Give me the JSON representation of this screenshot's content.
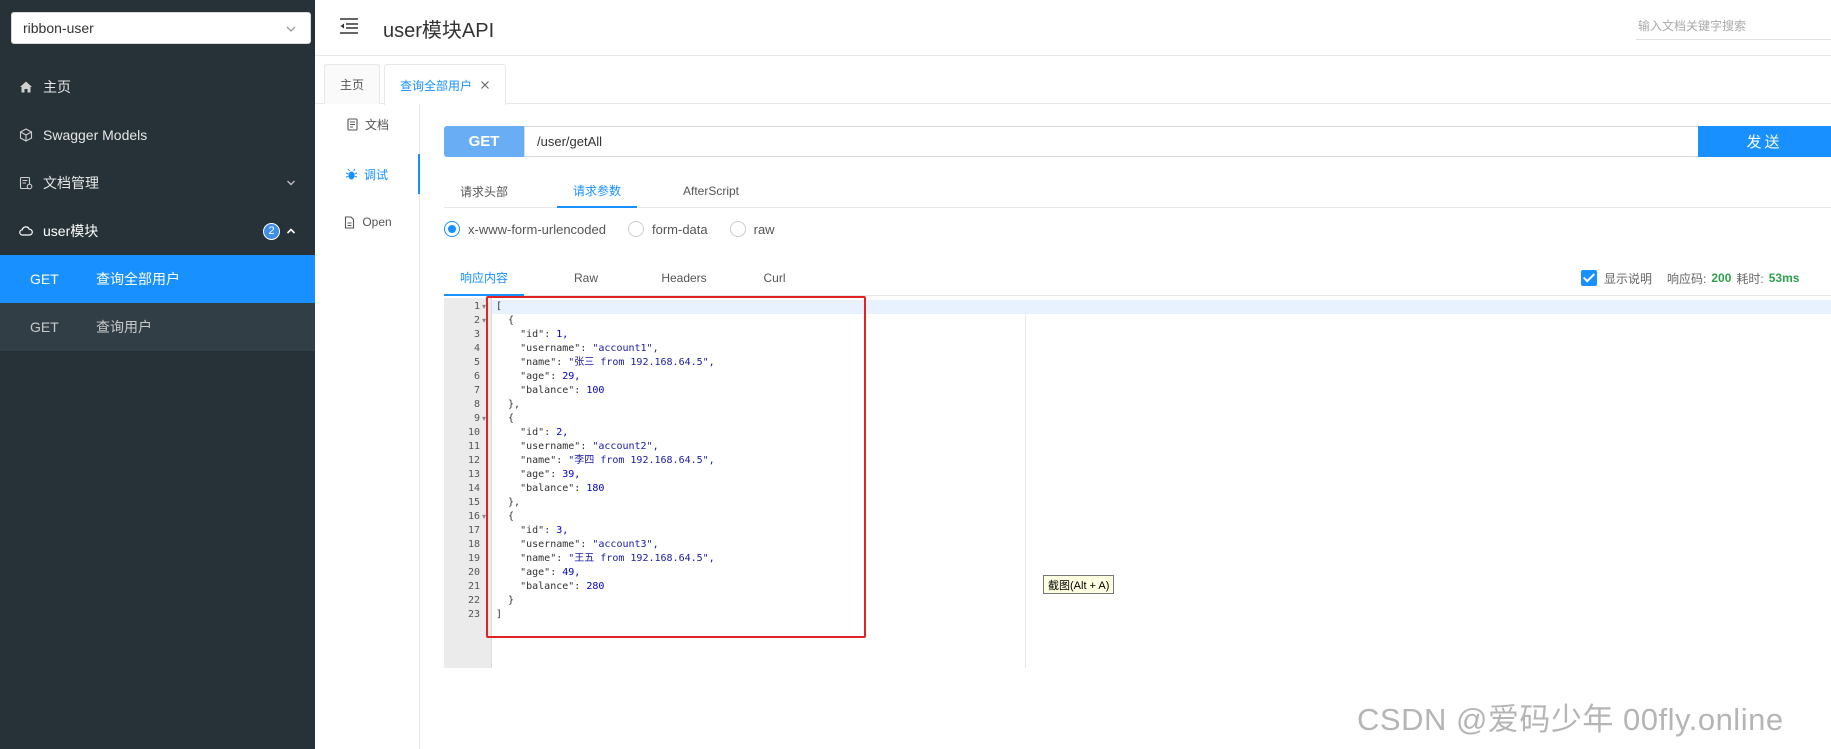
{
  "sidebar": {
    "group_value": "ribbon-user",
    "items": [
      {
        "label": "主页",
        "icon": "home-icon"
      },
      {
        "label": "Swagger Models",
        "icon": "cube-icon"
      },
      {
        "label": "文档管理",
        "icon": "doc-manage-icon"
      },
      {
        "label": "user模块",
        "icon": "cloud-icon",
        "badge": "2"
      }
    ],
    "sub_items": [
      {
        "method": "GET",
        "name": "查询全部用户",
        "active": true
      },
      {
        "method": "GET",
        "name": "查询用户",
        "active": false
      }
    ]
  },
  "header": {
    "title": "user模块API",
    "search_placeholder": "输入文档关键字搜索"
  },
  "page_tabs": [
    {
      "label": "主页"
    },
    {
      "label": "查询全部用户"
    }
  ],
  "side_tabs": [
    {
      "label": "文档"
    },
    {
      "label": "调试"
    },
    {
      "label": "Open"
    }
  ],
  "request": {
    "method": "GET",
    "url": "/user/getAll",
    "send_label": "发送"
  },
  "request_tabs": [
    "请求头部",
    "请求参数",
    "AfterScript"
  ],
  "body_types": [
    "x-www-form-urlencoded",
    "form-data",
    "raw"
  ],
  "response_tabs": [
    "响应内容",
    "Raw",
    "Headers",
    "Curl"
  ],
  "response_meta": {
    "show_desc_label": "显示说明",
    "status_label": "响应码:",
    "status_value": "200",
    "time_label": "耗时:",
    "time_value": "53ms"
  },
  "response_lines": [
    "[",
    "  {",
    "    \"id\": 1,",
    "    \"username\": \"account1\",",
    "    \"name\": \"张三 from 192.168.64.5\",",
    "    \"age\": 29,",
    "    \"balance\": 100",
    "  },",
    "  {",
    "    \"id\": 2,",
    "    \"username\": \"account2\",",
    "    \"name\": \"李四 from 192.168.64.5\",",
    "    \"age\": 39,",
    "    \"balance\": 180",
    "  },",
    "  {",
    "    \"id\": 3,",
    "    \"username\": \"account3\",",
    "    \"name\": \"王五 from 192.168.64.5\",",
    "    \"age\": 49,",
    "    \"balance\": 280",
    "  }",
    "]"
  ],
  "tooltip": "截图(Alt + A)",
  "watermark": "CSDN @爱码少年 00fly.online",
  "colors": {
    "sidebar_bg": "#263138",
    "accent": "#1890ff",
    "highlight": "#e02424"
  }
}
